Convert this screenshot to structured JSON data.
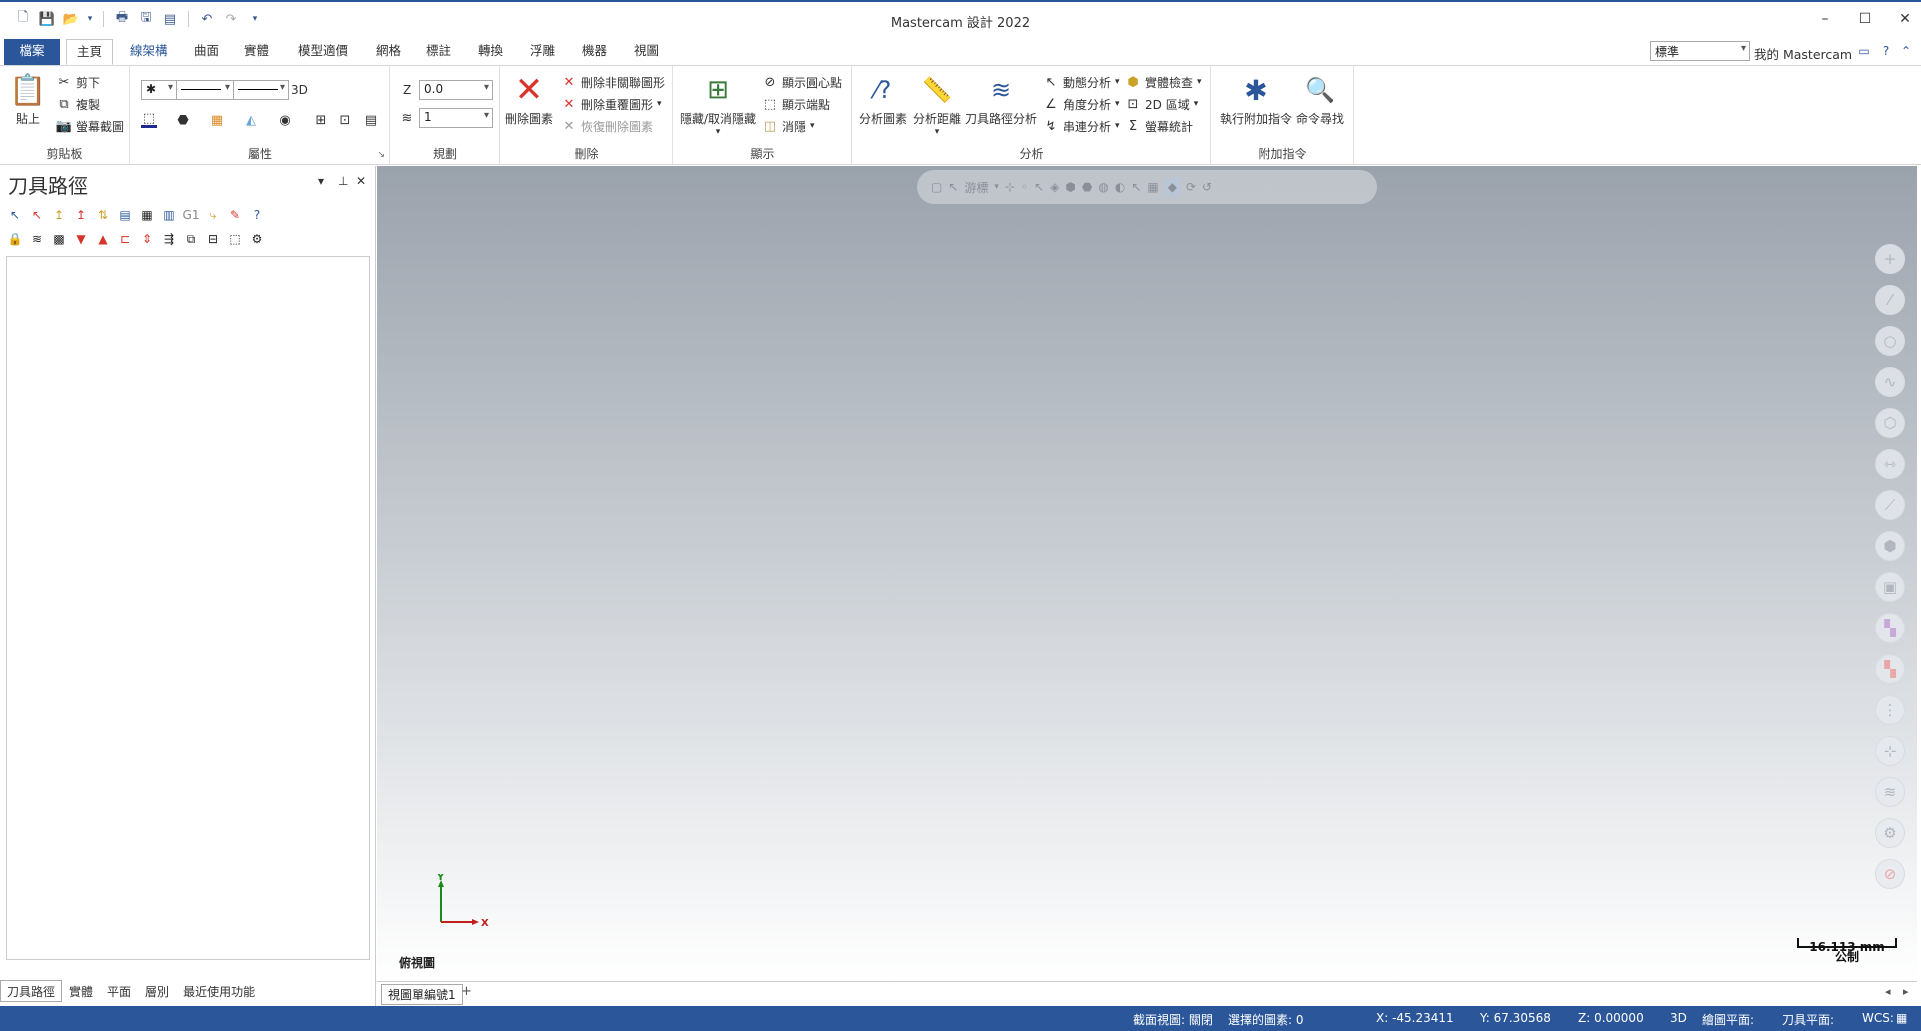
{
  "window": {
    "title": "Mastercam 設計 2022",
    "minimize": "–",
    "maximize": "☐",
    "close": "✕"
  },
  "ribbon_tabs": [
    "檔案",
    "主頁",
    "線架構",
    "曲面",
    "實體",
    "模型適價",
    "網格",
    "標註",
    "轉換",
    "浮雕",
    "機器",
    "視圖"
  ],
  "top_right": {
    "style_value": "標準",
    "my_mastercam": "我的 Mastercam"
  },
  "clipboard": {
    "paste": "貼上",
    "cut": "剪下",
    "copy": "複製",
    "screenshot": "螢幕截圖",
    "label": "剪貼板"
  },
  "attributes": {
    "label": "屬性",
    "mode": "3D"
  },
  "planning": {
    "z_label": "Z",
    "z_value": "0.0",
    "level_value": "1",
    "label": "規劃"
  },
  "delete": {
    "delete_entity": "刪除圖素",
    "delete_unrelated": "刪除非關聯圖形",
    "delete_duplicate": "刪除重覆圖形",
    "undelete": "恢復刪除圖素",
    "label": "刪除"
  },
  "display": {
    "hide_unhide": "隱藏/取消隱藏",
    "show_arc_center": "顯示圓心點",
    "show_endpoints": "顯示端點",
    "blank": "消隱",
    "label": "顯示"
  },
  "analyze": {
    "analyze_entity": "分析圖素",
    "analyze_distance": "分析距離",
    "toolpath_analysis": "刀具路徑分析",
    "dynamic": "動態分析",
    "angle": "角度分析",
    "chain": "串連分析",
    "solid_check": "實體檢查",
    "area_2d": "2D 區域",
    "statistics": "螢幕統計",
    "label": "分析"
  },
  "addins": {
    "run_addin": "執行附加指令",
    "find_command": "命令尋找",
    "label": "附加指令"
  },
  "panel": {
    "title": "刀具路徑",
    "tabs": [
      "刀具路徑",
      "實體",
      "平面",
      "層別",
      "最近使用功能"
    ]
  },
  "viewport": {
    "float_toolbar_label": "游標",
    "view_name": "俯視圖",
    "axis_x": "X",
    "axis_y": "Y",
    "scale_value": "16.113 mm",
    "scale_unit": "公制"
  },
  "viewsheet": {
    "tab": "視圖單編號1",
    "add": "+"
  },
  "status": {
    "section_view": "截面視圖: 關閉",
    "selected": "選擇的圖素: 0",
    "x": "X:   -45.23411",
    "y": "Y:   67.30568",
    "z": "Z:   0.00000",
    "mode": "3D",
    "cplane": "繪圖平面:",
    "tplane": "刀具平面:",
    "wcs": "WCS:"
  },
  "colors": {
    "accent": "#2b579a",
    "delete_red": "#d9342b"
  }
}
